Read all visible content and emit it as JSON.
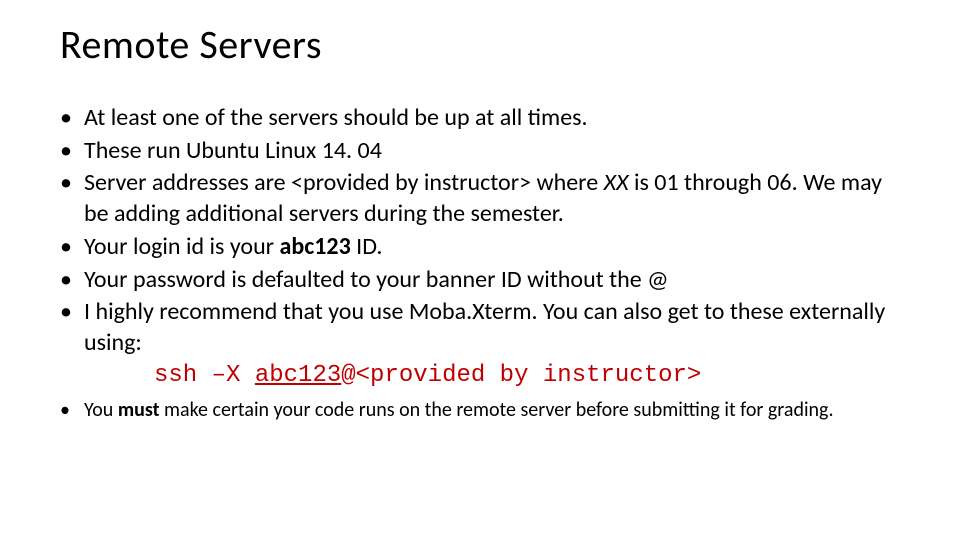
{
  "title": "Remote Servers",
  "bullets": {
    "b1": "At least one of the servers should be up at all times.",
    "b2": "These run Ubuntu Linux 14. 04",
    "b3_pre": "Server addresses  are ",
    "b3_placeholder": "<provided by instructor>",
    "b3_mid": " where ",
    "b3_xx": "XX",
    "b3_post": " is 01 through 06.  We may be adding additional servers during the semester.",
    "b4_pre": "Your login id is your ",
    "b4_bold": "abc123",
    "b4_post": " ID.",
    "b5": "Your password is defaulted to your banner ID without the @",
    "b6": "I highly recommend that you use Moba.Xterm.  You can also get to these externally using:",
    "ssh_cmd": "ssh –X ",
    "ssh_user": "abc123",
    "ssh_at": "@",
    "ssh_host": "<provided by instructor>",
    "b7_pre": "You ",
    "b7_bold": "must",
    "b7_post": " make certain your code runs on the remote server before submitting it for grading."
  }
}
